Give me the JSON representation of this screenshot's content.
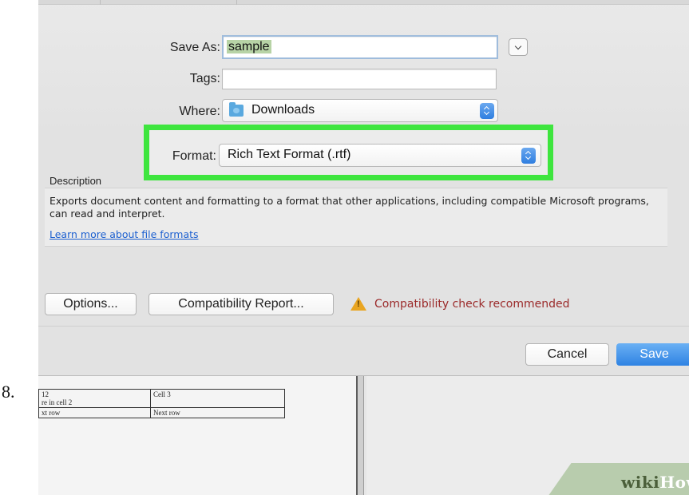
{
  "step_number": "8.",
  "dialog": {
    "save_as_label": "Save As:",
    "save_as_value": "sample",
    "tags_label": "Tags:",
    "tags_value": "",
    "where_label": "Where:",
    "where_value": "Downloads",
    "where_icon": "folder-icon",
    "format_label": "Format:",
    "format_value": "Rich Text Format (.rtf)",
    "highlight_color": "#3ee53e",
    "description_title": "Description",
    "description_text": "Exports document content and formatting to a format that other applications, including compatible Microsoft programs, can read and interpret.",
    "learn_more_link": "Learn more about file formats",
    "options_button": "Options...",
    "compat_report_button": "Compatibility Report...",
    "warning_icon": "warning-triangle-icon",
    "warning_text": "Compatibility check recommended",
    "cancel_button": "Cancel",
    "save_button": "Save"
  },
  "document": {
    "rows": [
      [
        "12\nre in cell 2",
        "Cell 3"
      ],
      [
        "xt row",
        "Next row"
      ]
    ]
  },
  "watermark": {
    "wiki": "wiki",
    "how": "How"
  }
}
